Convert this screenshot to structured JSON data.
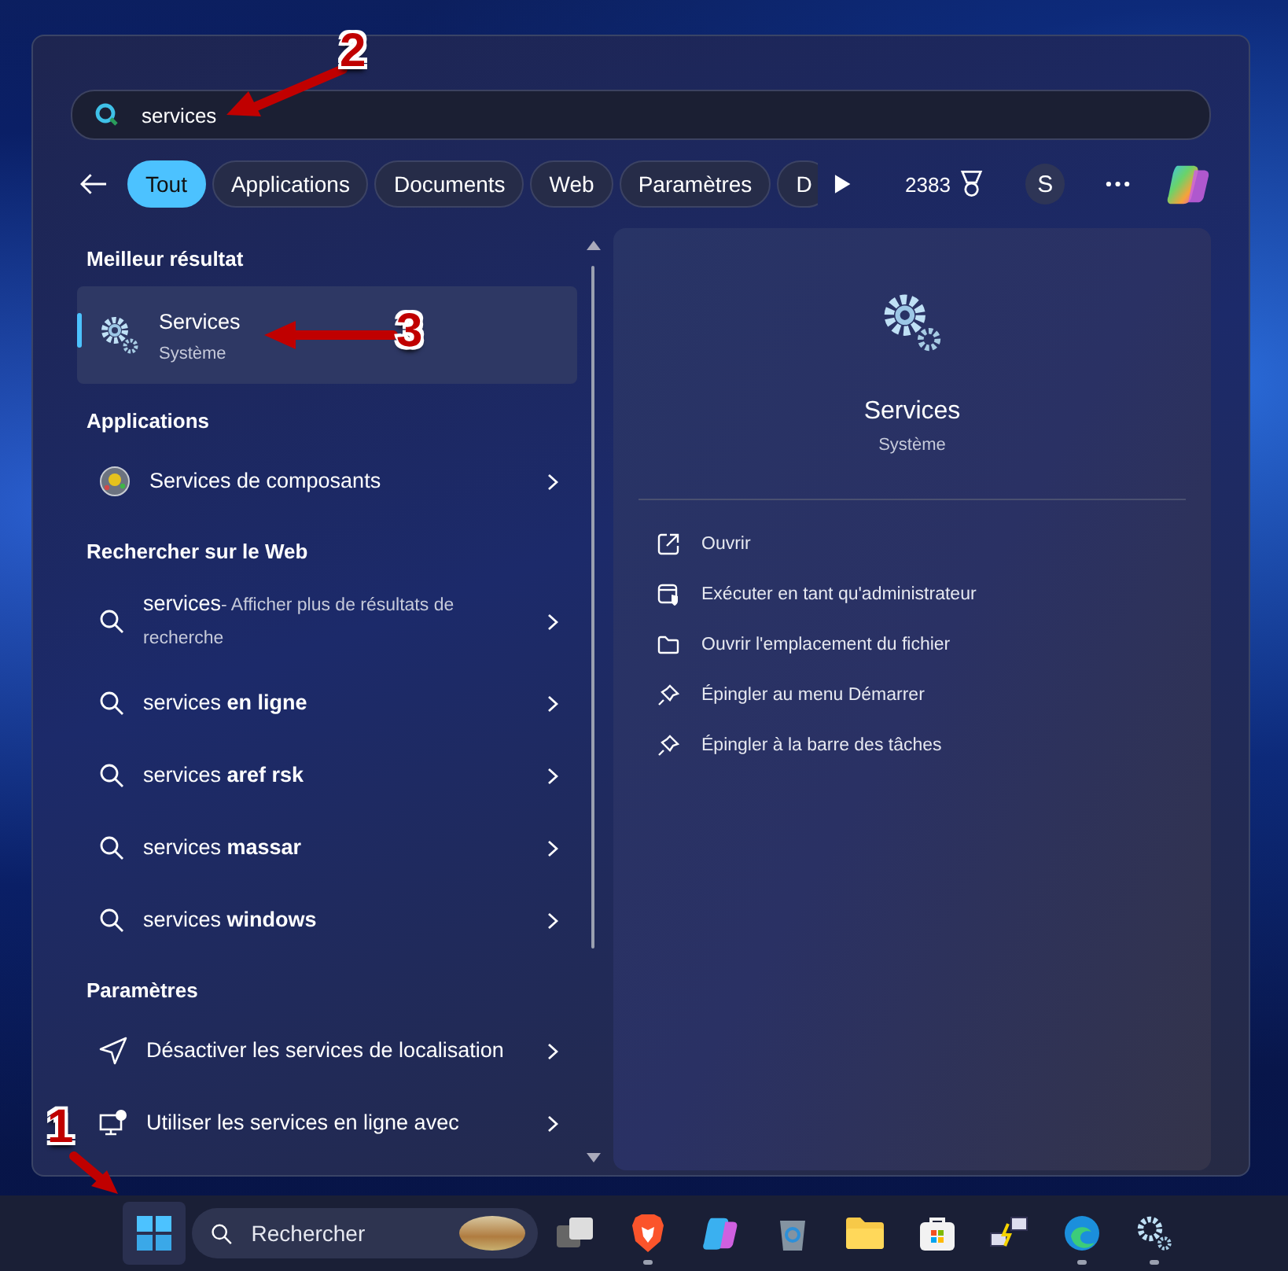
{
  "search": {
    "value": "services"
  },
  "filters": [
    {
      "label": "Tout",
      "selected": true
    },
    {
      "label": "Applications",
      "selected": false
    },
    {
      "label": "Documents",
      "selected": false
    },
    {
      "label": "Web",
      "selected": false
    },
    {
      "label": "Paramètres",
      "selected": false
    },
    {
      "label": "D",
      "selected": false
    }
  ],
  "rewards": {
    "points": "2383"
  },
  "account": {
    "initial": "S"
  },
  "sections": [
    {
      "heading": "Meilleur résultat",
      "items": [
        {
          "kind": "best",
          "title": "Services",
          "subtitle": "Système",
          "selected": true
        }
      ]
    },
    {
      "heading": "Applications",
      "items": [
        {
          "kind": "app",
          "title": "Services de composants",
          "selected": false
        }
      ]
    },
    {
      "heading": "Rechercher sur le Web",
      "items": [
        {
          "kind": "web",
          "title": "services",
          "hint": "- Afficher plus de résultats de recherche",
          "selected": false
        },
        {
          "kind": "web",
          "title": "services **en ligne**",
          "selected": false
        },
        {
          "kind": "web",
          "title": "services **aref rsk**",
          "selected": false
        },
        {
          "kind": "web",
          "title": "services **massar**",
          "selected": false
        },
        {
          "kind": "web",
          "title": "services **windows**",
          "selected": false
        }
      ]
    },
    {
      "heading": "Paramètres",
      "items": [
        {
          "kind": "location",
          "title": "Désactiver les services de localisation",
          "selected": false
        },
        {
          "kind": "narrator",
          "title": "Utiliser les services en ligne avec",
          "selected": false
        }
      ]
    }
  ],
  "detail": {
    "title": "Services",
    "subtitle": "Système",
    "actions": [
      {
        "kind": "open",
        "label": "Ouvrir"
      },
      {
        "kind": "admin",
        "label": "Exécuter en tant qu'administrateur"
      },
      {
        "kind": "folder",
        "label": "Ouvrir l'emplacement du fichier"
      },
      {
        "kind": "pin",
        "label": "Épingler au menu Démarrer"
      },
      {
        "kind": "pin",
        "label": "Épingler à la barre des tâches"
      }
    ]
  },
  "taskbar": {
    "search_placeholder": "Rechercher",
    "apps": [
      {
        "kind": "taskview",
        "running": false
      },
      {
        "kind": "brave",
        "running": true
      },
      {
        "kind": "copilot",
        "running": false
      },
      {
        "kind": "recycle",
        "running": false
      },
      {
        "kind": "folder",
        "running": false
      },
      {
        "kind": "store",
        "running": false
      },
      {
        "kind": "network",
        "running": false
      },
      {
        "kind": "edge",
        "running": true
      },
      {
        "kind": "gear",
        "running": true
      }
    ]
  },
  "annotations": [
    {
      "number": "1"
    },
    {
      "number": "2"
    },
    {
      "number": "3"
    }
  ]
}
